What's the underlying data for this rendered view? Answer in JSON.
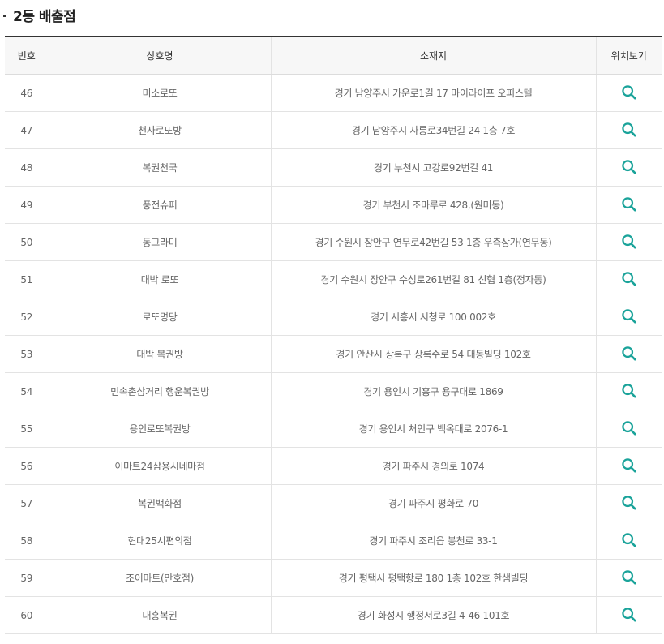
{
  "section": {
    "title": "2등 배출점"
  },
  "table": {
    "headers": [
      "번호",
      "상호명",
      "소재지",
      "위치보기"
    ],
    "rows": [
      {
        "no": "46",
        "name": "미소로또",
        "address": "경기 남양주시 가운로1길 17 마이라이프 오피스텔"
      },
      {
        "no": "47",
        "name": "천사로또방",
        "address": "경기 남양주시 사릉로34번길 24 1층 7호"
      },
      {
        "no": "48",
        "name": "복권천국",
        "address": "경기 부천시 고강로92번길 41"
      },
      {
        "no": "49",
        "name": "풍전슈퍼",
        "address": "경기 부천시 조마루로 428,(원미동)"
      },
      {
        "no": "50",
        "name": "동그라미",
        "address": "경기 수원시 장안구 연무로42번길 53 1층 우측상가(연무동)"
      },
      {
        "no": "51",
        "name": "대박 로또",
        "address": "경기 수원시 장안구 수성로261번길 81 신협 1층(정자동)"
      },
      {
        "no": "52",
        "name": "로또명당",
        "address": "경기 시흥시 시청로 100 002호"
      },
      {
        "no": "53",
        "name": "대박 복권방",
        "address": "경기 안산시 상록구 상록수로 54 대동빌딩 102호"
      },
      {
        "no": "54",
        "name": "민속촌삼거리 행운복권방",
        "address": "경기 용인시 기흥구 용구대로 1869"
      },
      {
        "no": "55",
        "name": "용인로또복권방",
        "address": "경기 용인시 처인구 백옥대로 2076-1"
      },
      {
        "no": "56",
        "name": "이마트24삼용시네마점",
        "address": "경기 파주시 경의로 1074"
      },
      {
        "no": "57",
        "name": "복권백화점",
        "address": "경기 파주시 평화로 70"
      },
      {
        "no": "58",
        "name": "현대25시편의점",
        "address": "경기 파주시 조리읍 봉천로 33-1"
      },
      {
        "no": "59",
        "name": "조이마트(만호점)",
        "address": "경기 평택시 평택항로 180 1층 102호 한샘빌딩"
      },
      {
        "no": "60",
        "name": "대흥복권",
        "address": "경기 화성시 행정서로3길 4-46 101호"
      }
    ]
  },
  "icons": {
    "location": "search-icon"
  },
  "colors": {
    "icon": "#1aa39a",
    "header_bg": "#f7f7f7",
    "header_top_border": "#333333",
    "row_border": "#e3e3e3"
  }
}
